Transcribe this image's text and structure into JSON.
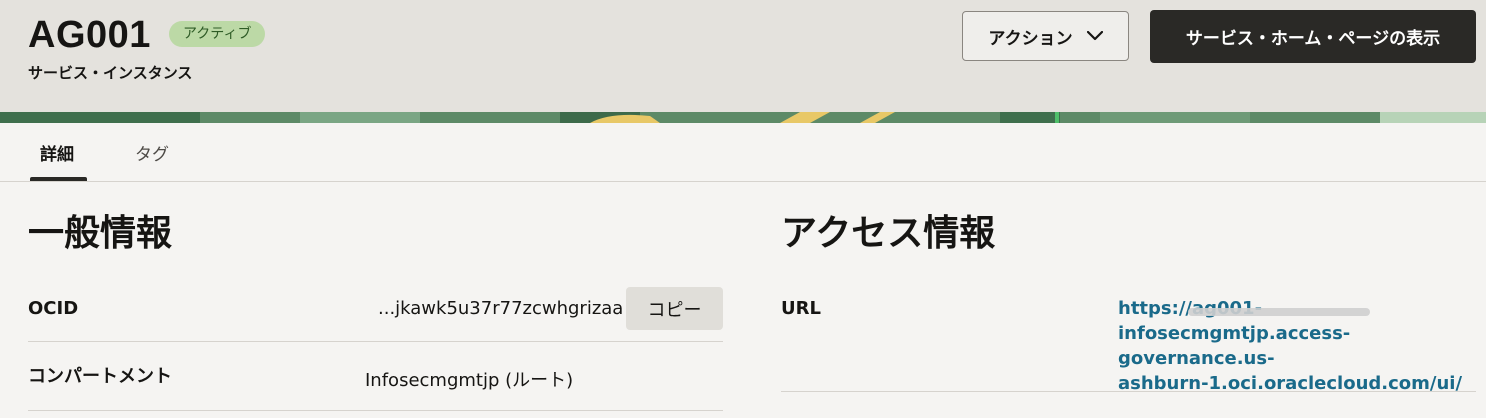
{
  "header": {
    "title": "AG001",
    "status_badge": "アクティブ",
    "subtitle": "サービス・インスタンス",
    "action_button": "アクション",
    "home_button": "サービス・ホーム・ページの表示"
  },
  "tabs": [
    {
      "label": "詳細",
      "active": true
    },
    {
      "label": "タグ",
      "active": false
    }
  ],
  "general_info": {
    "title": "一般情報",
    "ocid_label": "OCID",
    "ocid_value": "...jkawk5u37r77zcwhgrizaa",
    "copy_button": "コピー",
    "compartment_label": "コンパートメント",
    "compartment_value": "Infosecmgmtjp (ルート)"
  },
  "access_info": {
    "title": "アクセス情報",
    "url_label": "URL",
    "url_lines": [
      "https://ag001-infosecmgmtjp.access-",
      "governance.us-",
      "ashburn-1.oci.oraclecloud.com/ui/"
    ]
  },
  "colors": {
    "badge_bg": "#bcd9a6",
    "link": "#1a6a8a",
    "primary_button": "#2a2926"
  },
  "icons": {
    "action_dropdown": "chevron-down-icon"
  }
}
